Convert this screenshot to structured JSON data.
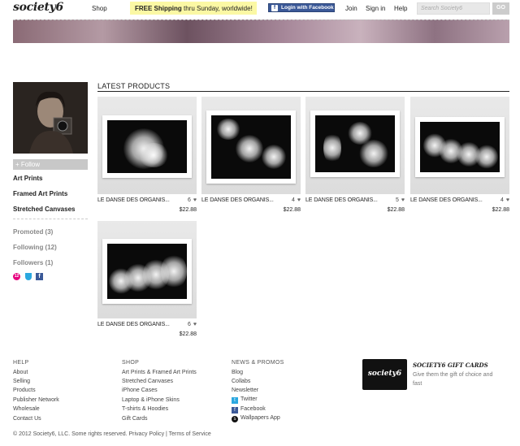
{
  "header": {
    "logo": "society6",
    "shop": "Shop",
    "promo_bold": "FREE Shipping",
    "promo_rest": " thru Sunday, worldwide!",
    "facebook_login": "Login with Facebook",
    "join": "Join",
    "sign_in": "Sign in",
    "help": "Help",
    "search_placeholder": "Search Society6",
    "go": "GO"
  },
  "sidebar": {
    "follow": "+ Follow",
    "links": [
      "Art Prints",
      "Framed Art Prints",
      "Stretched Canvases"
    ],
    "stats": [
      "Promoted (3)",
      "Following (12)",
      "Followers (1)"
    ],
    "badge_count": "12"
  },
  "products": {
    "section_title": "LATEST PRODUCTS",
    "items": [
      {
        "title": "LE DANSE DES ORGANIS...",
        "likes": "6",
        "price": "$22.88"
      },
      {
        "title": "LE DANSE DES ORGANIS...",
        "likes": "4",
        "price": "$22.88"
      },
      {
        "title": "LE DANSE DES ORGANIS...",
        "likes": "5",
        "price": "$22.88"
      },
      {
        "title": "LE DANSE DES ORGANIS...",
        "likes": "4",
        "price": "$22.88"
      },
      {
        "title": "LE DANSE DES ORGANIS...",
        "likes": "6",
        "price": "$22.88"
      }
    ]
  },
  "footer": {
    "help": {
      "heading": "HELP",
      "links": [
        "About",
        "Selling",
        "Products",
        "Publisher Network",
        "Wholesale",
        "Contact Us"
      ]
    },
    "shop": {
      "heading": "SHOP",
      "links": [
        "Art Prints & Framed Art Prints",
        "Stretched Canvases",
        "iPhone Cases",
        "Laptop & iPhone Skins",
        "T-shirts & Hoodies",
        "Gift Cards"
      ]
    },
    "news": {
      "heading": "NEWS & PROMOS",
      "links": [
        "Blog",
        "Collabs",
        "Newsletter",
        "Twitter",
        "Facebook",
        "Wallpapers App"
      ]
    },
    "gift": {
      "card_logo": "society6",
      "title": "SOCIETY6 GIFT CARDS",
      "desc": "Give them the gift of choice and fast"
    },
    "copyright": "© 2012 Society6, LLC. Some rights reserved. Privacy Policy | Terms of Service"
  },
  "colors": {
    "promo_bg": "#fbf8a4",
    "facebook": "#3b5998",
    "badge": "#e6007e"
  }
}
